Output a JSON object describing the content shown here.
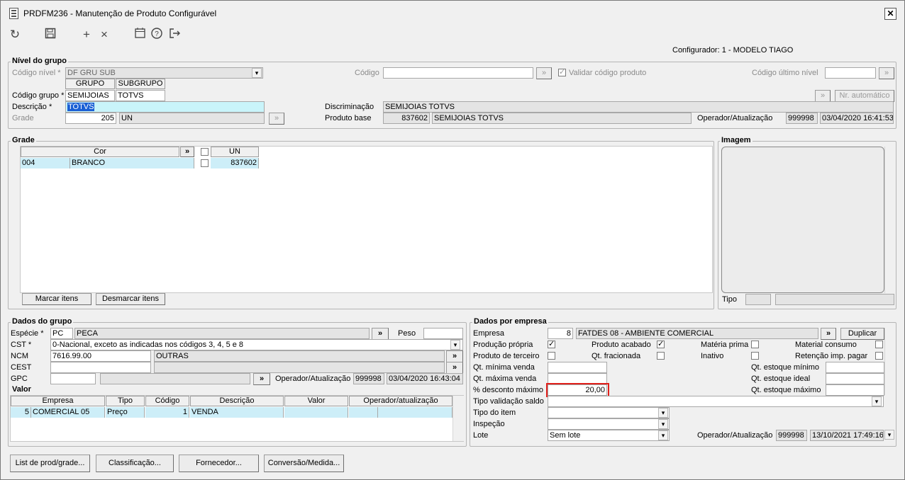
{
  "window": {
    "title": "PRDFM236 - Manutenção de Produto Configurável",
    "close": "✕"
  },
  "toolbar": {
    "icons": [
      "refresh-icon",
      "save-icon",
      "add-icon",
      "delete-icon",
      "calendar-icon",
      "help-icon",
      "exit-icon"
    ]
  },
  "configurador": "Configurador: 1 - MODELO TIAGO",
  "nivel": {
    "title": "Nível do grupo",
    "codigo_nivel_label": "Código nível *",
    "codigo_nivel_value": "DF GRU SUB",
    "codigo_label": "Código",
    "validar_label": "Validar código produto",
    "ultimo_nivel_label": "Código último nível",
    "grupo_header": "GRUPO",
    "subgrupo_header": "SUBGRUPO",
    "codigo_grupo_label": "Código grupo *",
    "grupo_value": "SEMIJOIAS",
    "subgrupo_value": "TOTVS",
    "nr_automatico": "Nr. automático",
    "descricao_label": "Descrição *",
    "descricao_value": "TOTVS",
    "discriminacao_label": "Discriminação",
    "discriminacao_value": "SEMIJOIAS TOTVS",
    "grade_label": "Grade",
    "grade_value": "205",
    "grade_unit": "UN",
    "produto_base_label": "Produto base",
    "produto_base_code": "837602",
    "produto_base_desc": "SEMIJOIAS TOTVS",
    "operador_label": "Operador/Atualização",
    "operador_value": "999998",
    "operador_date": "03/04/2020 16:41:53"
  },
  "grade": {
    "title": "Grade",
    "col_cor": "Cor",
    "col_un": "UN",
    "row_code": "004",
    "row_desc": "BRANCO",
    "row_un": "837602",
    "marcar": "Marcar itens",
    "desmarcar": "Desmarcar itens"
  },
  "imagem": {
    "title": "Imagem",
    "tipo_label": "Tipo"
  },
  "dados_grupo": {
    "title": "Dados do grupo",
    "especie_label": "Espécie *",
    "especie_code": "PC",
    "especie_desc": "PECA",
    "peso_label": "Peso",
    "cst_label": "CST *",
    "cst_value": "0-Nacional, exceto as indicadas nos códigos 3, 4, 5 e 8",
    "ncm_label": "NCM",
    "ncm_value": "7616.99.00",
    "ncm_desc": "OUTRAS",
    "cest_label": "CEST",
    "gpc_label": "GPC",
    "operador_label": "Operador/Atualização",
    "operador_value": "999998",
    "operador_date": "03/04/2020 16:43:04"
  },
  "valor": {
    "title": "Valor",
    "headers": [
      "Empresa",
      "Tipo",
      "Código",
      "Descrição",
      "Valor",
      "Operador/atualização"
    ],
    "row": {
      "empresa_num": "5",
      "empresa": "COMERCIAL 05",
      "tipo": "Preço",
      "codigo": "1",
      "descricao": "VENDA"
    }
  },
  "dados_empresa": {
    "title": "Dados por empresa",
    "empresa_label": "Empresa",
    "empresa_code": "8",
    "empresa_desc": "FATDES 08 - AMBIENTE COMERCIAL",
    "duplicar": "Duplicar",
    "producao_propria": "Produção própria",
    "produto_acabado": "Produto acabado",
    "materia_prima": "Matéria prima",
    "material_consumo": "Material consumo",
    "produto_terceiro": "Produto de terceiro",
    "qt_fracionada": "Qt. fracionada",
    "inativo": "Inativo",
    "retencao": "Retenção imp. pagar",
    "qt_min_venda": "Qt. mínima venda",
    "qt_est_min": "Qt. estoque mínimo",
    "qt_max_venda": "Qt. máxima venda",
    "qt_est_ideal": "Qt. estoque ideal",
    "desconto_label": "% desconto máximo",
    "desconto_value": "20,00",
    "qt_est_max": "Qt. estoque máximo",
    "tipo_validacao": "Tipo validação saldo",
    "tipo_item": "Tipo do item",
    "inspecao": "Inspeção",
    "lote_label": "Lote",
    "lote_value": "Sem lote",
    "operador_label": "Operador/Atualização",
    "operador_value": "999998",
    "operador_date": "13/10/2021 17:49:16",
    "highlight_color": "#e0201b"
  },
  "bottom": {
    "list": "List de prod/grade...",
    "classificacao": "Classificação...",
    "fornecedor": "Fornecedor...",
    "conversao": "Conversão/Medida..."
  }
}
